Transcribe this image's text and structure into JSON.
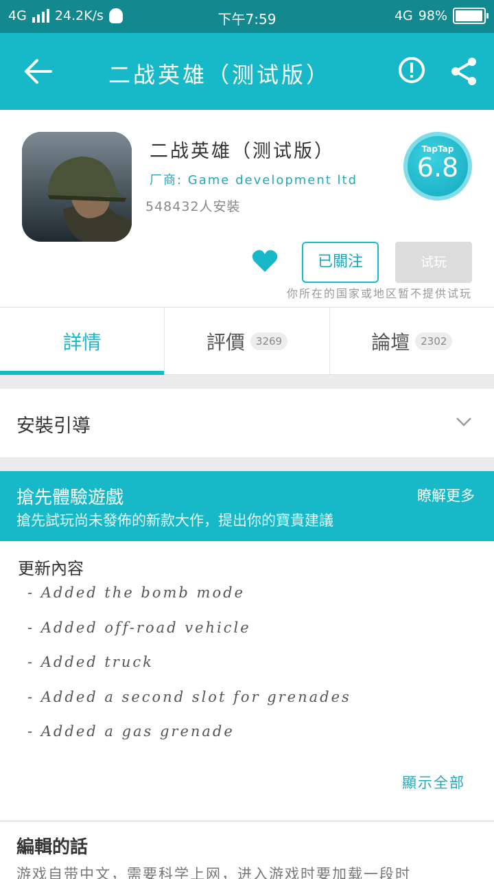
{
  "status_bar": {
    "network": "4G",
    "speed": "24.2K/s",
    "time": "下午7:59",
    "network_right": "4G",
    "battery": "98%",
    "battery_level": 0.98
  },
  "app_bar": {
    "title": "二战英雄（测试版）"
  },
  "app": {
    "name": "二战英雄（测试版）",
    "vendor": "厂商: Game development ltd",
    "installs": "548432人安裝",
    "score_brand": "TapTap",
    "score": "6.8"
  },
  "actions": {
    "follow_label": "已關注",
    "trial_label": "试玩",
    "notice": "你所在的国家或地区暂不提供试玩"
  },
  "tabs": [
    {
      "label": "詳情",
      "count": ""
    },
    {
      "label": "評價",
      "count": "3269"
    },
    {
      "label": "論壇",
      "count": "2302"
    }
  ],
  "install_guide": {
    "label": "安裝引導"
  },
  "beta": {
    "title": "搶先體驗遊戲",
    "subtitle": "搶先試玩尚未發佈的新款大作，提出你的寶貴建議",
    "more": "瞭解更多"
  },
  "changelog": {
    "heading": "更新內容",
    "items": [
      "- Added the bomb mode",
      "- Added off-road vehicle",
      "- Added truck",
      "- Added a second slot for grenades",
      "- Added a gas grenade"
    ],
    "show_all": "顯示全部"
  },
  "editor": {
    "heading": "編輯的話",
    "body": "游戏自带中文，需要科学上网，进入游戏时要加载一段时"
  },
  "colors": {
    "accent": "#17b9c9",
    "status_bar": "#12888f"
  }
}
